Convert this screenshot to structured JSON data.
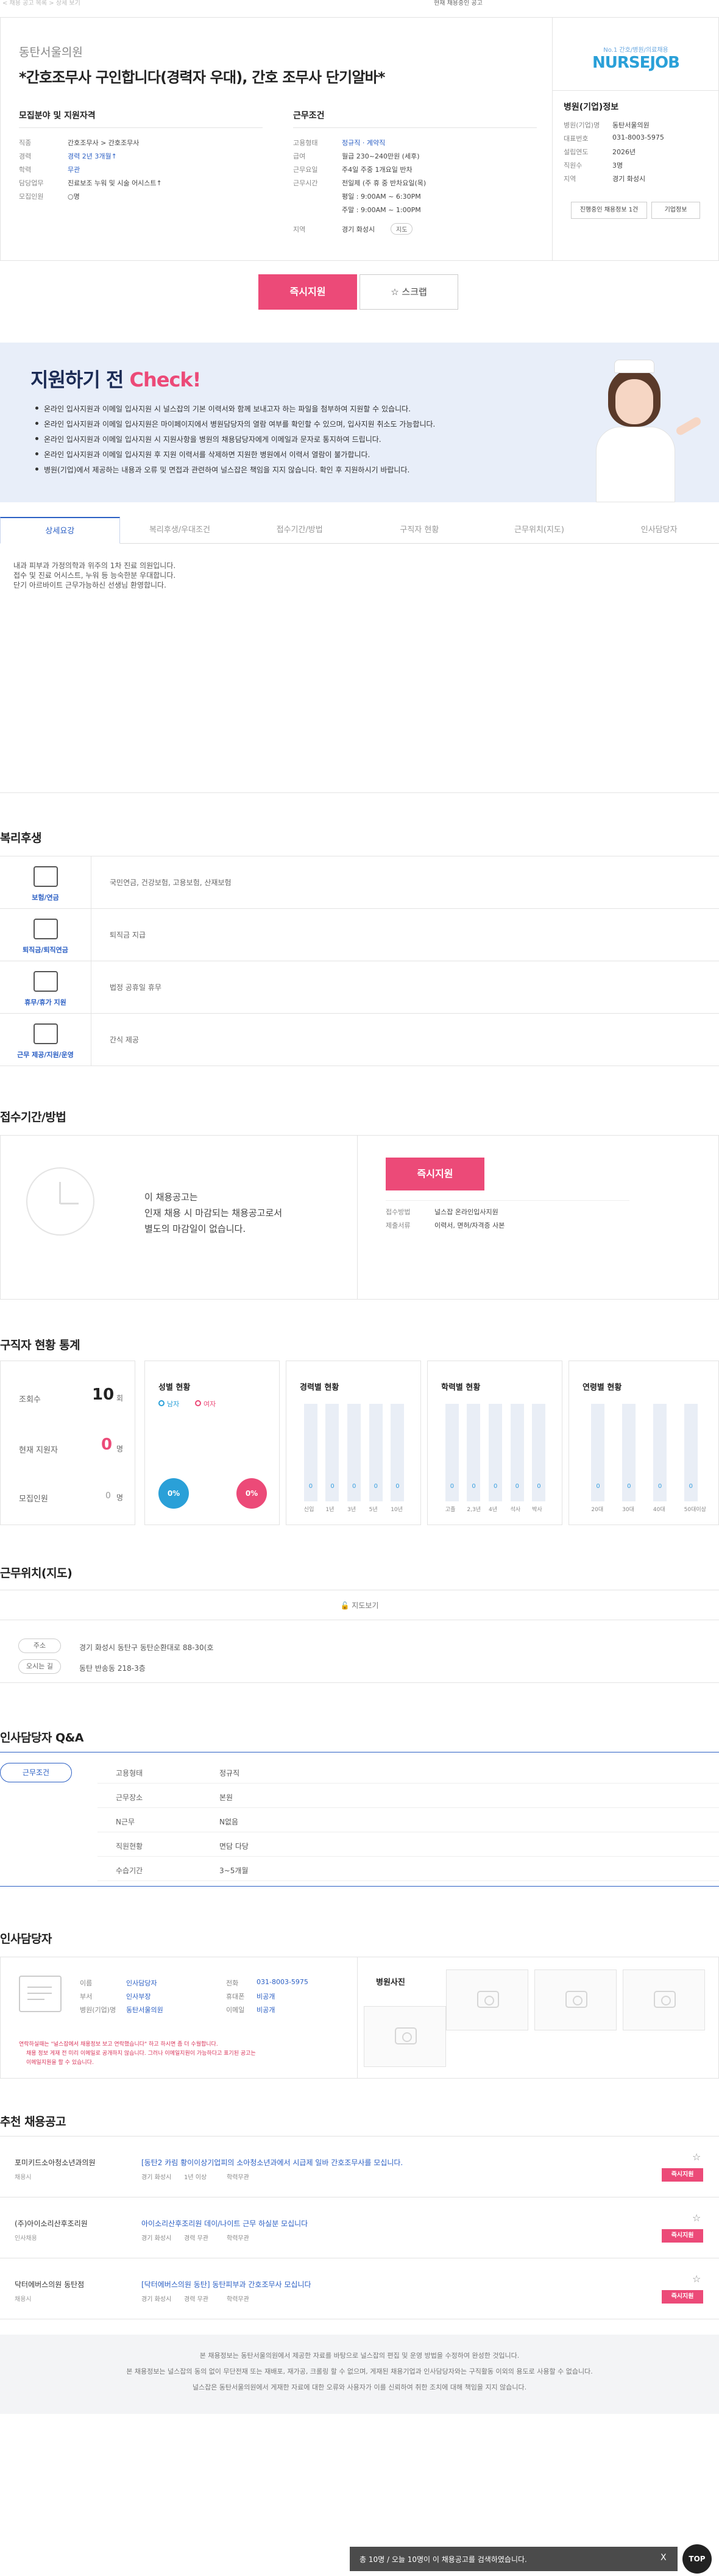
{
  "top": {
    "breadcrumb": "< 채용 공고 목록 > 상세 보기",
    "status": "현재 채용중인 공고"
  },
  "header": {
    "hospital": "동탄서울의원",
    "title": "*간호조무사 구인합니다(경력자 우대), 간호 조무사 단기알바*"
  },
  "recruit": {
    "heading": "모집분야 및 지원자격",
    "rows": [
      {
        "k": "직종",
        "v": "간호조무사 > 간호조무사"
      },
      {
        "k": "경력",
        "v": "경력 2년 3개월↑"
      },
      {
        "k": "학력",
        "v": "무관"
      },
      {
        "k": "담당업무",
        "v": "진료보조 누워 및 시술 어시스트↑"
      },
      {
        "k": "모집인원",
        "v": "○명"
      }
    ]
  },
  "conditions": {
    "heading": "근무조건",
    "rows": [
      {
        "k": "고용형태",
        "v": "정규직 · 계약직"
      },
      {
        "k": "급여",
        "v": "월급 230~240만원 (세후)"
      },
      {
        "k": "근무요일",
        "v": "주4일 주중 1개요일 반차"
      },
      {
        "k": "근무시간",
        "v": "전일제 (주 휴 중 반차요일(목)"
      },
      {
        "k": "",
        "v": "평일 : 9:00AM ~ 6:30PM"
      },
      {
        "k": "",
        "v": "주말 : 9:00AM ~ 1:00PM"
      },
      {
        "k": "지역",
        "v": "경기 화성시"
      }
    ],
    "map_btn": "지도"
  },
  "side": {
    "logo_top": "No.1 간호/병원/의료채용",
    "logo_main": "NURSEJOB",
    "heading": "병원(기업)정보",
    "rows": [
      {
        "k": "병원(기업)명",
        "v": "동탄서울의원"
      },
      {
        "k": "대표번호",
        "v": "031-8003-5975"
      },
      {
        "k": "설립연도",
        "v": "2026년"
      },
      {
        "k": "직원수",
        "v": "3명"
      },
      {
        "k": "지역",
        "v": "경기 화성시"
      }
    ],
    "btn1": "진행중인 채용정보 1건",
    "btn2": "기업정보"
  },
  "actions": {
    "apply": "즉시지원",
    "scrap": "☆ 스크랩"
  },
  "check": {
    "title_a": "지원하기 전 ",
    "title_b": "Check!",
    "items": [
      "온라인 입사지원과 이메일 입사지원 시 널스잡의 기본 이력서와 함께 보내고자 하는 파일을 첨부하여 지원할 수 있습니다.",
      "온라인 입사지원과 이메일 입사지원은 마이페이지에서 병원담당자의 열람 여부를 확인할 수 있으며, 입사지원 취소도 가능합니다.",
      "온라인 입사지원과 이메일 입사지원 시 지원사항을 병원의 채용담당자에게 이메일과 문자로 통지하여 드립니다.",
      "온라인 입사지원과 이메일 입사지원 후 지원 이력서를 삭제하면 지원한 병원에서 이력서 열람이 불가합니다.",
      "병원(기업)에서 제공하는 내용과 오류 및 면접과 관련하여 널스잡은 책임을 지지 않습니다. 확인 후 지원하시기 바랍니다."
    ]
  },
  "tabs": [
    "상세요강",
    "복리후생/우대조건",
    "접수기간/방법",
    "구직자 현황",
    "근무위치(지도)",
    "인사담당자"
  ],
  "detail": [
    "내과 피부과 가정의학과 위주의 1차 진료 의원입니다.",
    "접수 및 진료 어시스트, 누워 등 능숙한분 우대합니다.",
    "단기 아르바이트 근무가능하신 선생님 환영합니다."
  ],
  "welfare": {
    "title": "복리후생",
    "rows": [
      {
        "cap": "보험/연금",
        "text": "국민연금, 건강보험, 고용보험, 산재보험"
      },
      {
        "cap": "퇴직금/퇴직연금",
        "text": "퇴직금 지급"
      },
      {
        "cap": "휴무/휴가 지원",
        "text": "법정 공휴일 휴무"
      },
      {
        "cap": "근무 제공/지원/운영",
        "text": "간식 제공"
      }
    ]
  },
  "period": {
    "title": "접수기간/방법",
    "msg": [
      "이 채용공고는",
      "인재 채용 시 마감되는 채용공고로서",
      "별도의 마감일이 없습니다."
    ],
    "apply": "즉시지원",
    "rows": [
      {
        "k": "접수방법",
        "v": "널스잡 온라인입사지원"
      },
      {
        "k": "제출서류",
        "v": "이력서, 면허/자격증 사본"
      }
    ]
  },
  "stats": {
    "title": "구직자 현황 통계",
    "views_label": "조회수",
    "views": "10",
    "views_unit": "회",
    "applicants_label": "현재 지원자",
    "applicants": "0",
    "applicants_unit": "명",
    "recruit_label": "모집인원",
    "recruit": "0",
    "recruit_unit": "명",
    "gender_title": "성별 현황",
    "male": "남자",
    "female": "여자",
    "male_pct": "0%",
    "female_pct": "0%",
    "career_title": "경력별 현황",
    "career_labels": [
      "신입",
      "1년",
      "3년",
      "5년",
      "10년"
    ],
    "edu_title": "학력별 현황",
    "edu_labels": [
      "고졸",
      "2,3년",
      "4년",
      "석사",
      "박사"
    ],
    "age_title": "연령별 현황",
    "age_labels": [
      "20대",
      "30대",
      "40대",
      "50대이상"
    ],
    "zero": "0"
  },
  "location": {
    "title": "근무위치(지도)",
    "map_btn": "지도보기",
    "addr_label": "주소",
    "addr": "경기 화성시 동탄구 동탄순환대로 88-30(호",
    "route_label": "오시는 길",
    "route": "동탄 반송동 218-3층"
  },
  "qa": {
    "title": "인사담당자 Q&A",
    "tab": "근무조건",
    "rows": [
      {
        "k": "고용형태",
        "v": "정규직"
      },
      {
        "k": "근무장소",
        "v": "본원"
      },
      {
        "k": "N근무",
        "v": "N없음"
      },
      {
        "k": "직원현황",
        "v": "면담 다당"
      },
      {
        "k": "수습기간",
        "v": "3~5개월"
      }
    ]
  },
  "manager": {
    "title": "인사담당자",
    "rows": [
      {
        "k": "이름",
        "v": "인사담당자"
      },
      {
        "k": "부서",
        "v": "인사부장"
      },
      {
        "k": "병원(기업)명",
        "v": "동탄서울의원"
      }
    ],
    "rows2": [
      {
        "k": "전화",
        "v": "031-8003-5975"
      },
      {
        "k": "휴대폰",
        "v": "비공개"
      },
      {
        "k": "이메일",
        "v": "비공개"
      }
    ],
    "warn": [
      "연락하실때는 \"널스잡에서 채용정보 보고 연락했습니다\" 하고 하시면 좀 더 수월합니다.",
      "채용 정보 게재 전 미리 이메일로 공개하지 않습니다. 그러나 이메일지원이 가능하다고 표기된 공고는",
      "이메일지원을 할 수 있습니다."
    ],
    "photo_title": "병원사진"
  },
  "recommend": {
    "title": "추천 채용공고",
    "items": [
      {
        "org": "포미키드소아청소년과의원",
        "type": "채용시",
        "title": "[동탄2 카림 황이이상기업피의 소아청소년과에서 시급제 일바 간호조무사를 모십니다.",
        "meta": [
          "경기 화성시",
          "1년 이상",
          "학력무관"
        ],
        "btn": "즉시지원"
      },
      {
        "org": "(주)아이소리산후조리원",
        "type": "인사채용",
        "title": "아이소리산후조리원 데이/나이트 근무 하실분 모십니다",
        "meta": [
          "경기 화성시",
          "경력 무관",
          "학력무관"
        ],
        "btn": "즉시지원"
      },
      {
        "org": "닥터에버스의원 동탄점",
        "type": "채용시",
        "title": "[닥터에버스의원 동탄] 동탄피부과 간호조무사 모십니다",
        "meta": [
          "경기 화성시",
          "경력 무관",
          "학력무관"
        ],
        "btn": "즉시지원"
      }
    ]
  },
  "footer": [
    "본 채용정보는 동탄서울의원에서 제공한 자료를 바탕으로 널스잡의 편집 및 운영 방법을 수정하여 완성한 것입니다.",
    "본 채용정보는 널스잡의 동의 없이 무단전재 또는 재배포, 재가공, 크롤링 할 수 없으며, 게재된 채용기업과 인사담당자와는 구직활동 이외의 용도로 사용할 수 없습니다.",
    "널스잡은 동탄서울의원에서 게재한 자료에 대한 오류와 사용자가 이를 신뢰하여 취한 조치에 대해 책임을 지지 않습니다."
  ],
  "bottom_bar": {
    "text": "총 10명 / 오늘 10명이 이 채용공고를 검색하였습니다.",
    "close": "X"
  },
  "top_btn": "TOP",
  "colors": {
    "accent": "#ec4a78",
    "blue": "#2b5fc4",
    "check_bg": "#e8eef9"
  }
}
